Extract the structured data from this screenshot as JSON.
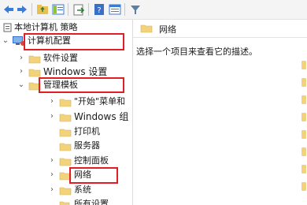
{
  "colors": {
    "folder": "#f2d27b",
    "highlight_box": "#e01e25",
    "back_arrow": "#3a7bd5"
  },
  "toolbar": {
    "icons": [
      "back-arrow-icon",
      "forward-arrow-icon",
      "up-folder-icon",
      "show-hide-tree-icon",
      "export-list-icon",
      "help-icon",
      "properties-icon",
      "filter-icon"
    ]
  },
  "tree": {
    "root_label": "本地计算机 策略",
    "computer_config": "计算机配置",
    "software_settings": "软件设置",
    "windows_settings": "Windows 设置",
    "admin_templates": "管理模板",
    "start_menu": "\"开始\"菜单和",
    "windows_components": "Windows 组",
    "printers": "打印机",
    "server": "服务器",
    "control_panel": "控制面板",
    "network": "网络",
    "system": "系统",
    "all_settings": "所有设置"
  },
  "right_pane": {
    "header_title": "网络",
    "description": "选择一个项目来查看它的描述。"
  }
}
